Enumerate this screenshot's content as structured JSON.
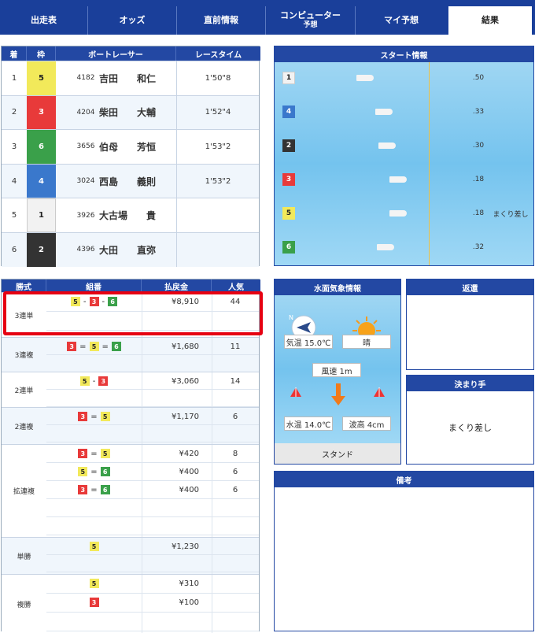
{
  "tabs": [
    {
      "label": "出走表"
    },
    {
      "label": "オッズ"
    },
    {
      "label": "直前情報"
    },
    {
      "label": "コンピューター",
      "sub": "予想"
    },
    {
      "label": "マイ予想"
    },
    {
      "label": "結果"
    }
  ],
  "results": {
    "headers": [
      "着",
      "枠",
      "ボートレーサー",
      "レースタイム"
    ],
    "rows": [
      {
        "rank": "1",
        "lane": "5",
        "id": "4182",
        "name": "吉田　　和仁",
        "time": "1'50\"8"
      },
      {
        "rank": "2",
        "lane": "3",
        "id": "4204",
        "name": "柴田　　大輔",
        "time": "1'52\"4"
      },
      {
        "rank": "3",
        "lane": "6",
        "id": "3656",
        "name": "伯母　　芳恒",
        "time": "1'53\"2"
      },
      {
        "rank": "4",
        "lane": "4",
        "id": "3024",
        "name": "西島　　義則",
        "time": "1'53\"2"
      },
      {
        "rank": "5",
        "lane": "1",
        "id": "3926",
        "name": "大古場　　貴",
        "time": ""
      },
      {
        "rank": "6",
        "lane": "2",
        "id": "4396",
        "name": "大田　　直弥",
        "time": ""
      }
    ]
  },
  "start": {
    "title": "スタート情報",
    "rows": [
      {
        "lane": "1",
        "st": ".50",
        "note": ""
      },
      {
        "lane": "4",
        "st": ".33",
        "note": ""
      },
      {
        "lane": "2",
        "st": ".30",
        "note": ""
      },
      {
        "lane": "3",
        "st": ".18",
        "note": ""
      },
      {
        "lane": "5",
        "st": ".18",
        "note": "まくり差し"
      },
      {
        "lane": "6",
        "st": ".32",
        "note": ""
      }
    ]
  },
  "payout": {
    "headers": [
      "勝式",
      "組番",
      "払戻金",
      "人気"
    ],
    "groups": [
      {
        "type": "3連単",
        "rows": [
          {
            "combo": [
              "5",
              "3",
              "6"
            ],
            "sep": "-",
            "amount": "¥8,910",
            "pop": "44"
          }
        ]
      },
      {
        "type": "3連複",
        "rows": [
          {
            "combo": [
              "3",
              "5",
              "6"
            ],
            "sep": "=",
            "amount": "¥1,680",
            "pop": "11"
          }
        ]
      },
      {
        "type": "2連単",
        "rows": [
          {
            "combo": [
              "5",
              "3"
            ],
            "sep": "-",
            "amount": "¥3,060",
            "pop": "14"
          }
        ]
      },
      {
        "type": "2連複",
        "rows": [
          {
            "combo": [
              "3",
              "5"
            ],
            "sep": "=",
            "amount": "¥1,170",
            "pop": "6"
          }
        ]
      },
      {
        "type": "拡連複",
        "rows": [
          {
            "combo": [
              "3",
              "5"
            ],
            "sep": "=",
            "amount": "¥420",
            "pop": "8"
          },
          {
            "combo": [
              "5",
              "6"
            ],
            "sep": "=",
            "amount": "¥400",
            "pop": "6"
          },
          {
            "combo": [
              "3",
              "6"
            ],
            "sep": "=",
            "amount": "¥400",
            "pop": "6"
          }
        ]
      },
      {
        "type": "単勝",
        "rows": [
          {
            "combo": [
              "5"
            ],
            "sep": "",
            "amount": "¥1,230",
            "pop": ""
          }
        ]
      },
      {
        "type": "複勝",
        "rows": [
          {
            "combo": [
              "5"
            ],
            "sep": "",
            "amount": "¥310",
            "pop": ""
          },
          {
            "combo": [
              "3"
            ],
            "sep": "",
            "amount": "¥100",
            "pop": ""
          }
        ]
      }
    ]
  },
  "weather": {
    "title": "水面気象情報",
    "wind_dir": "N",
    "temp": "気温 15.0℃",
    "weather": "晴",
    "wind": "風速 1m",
    "water_temp": "水温 14.0℃",
    "wave": "波高 4cm",
    "stand": "スタンド"
  },
  "refund": {
    "title": "返還"
  },
  "kimarite": {
    "title": "決まり手",
    "value": "まくり差し"
  },
  "remarks": {
    "title": "備考"
  }
}
